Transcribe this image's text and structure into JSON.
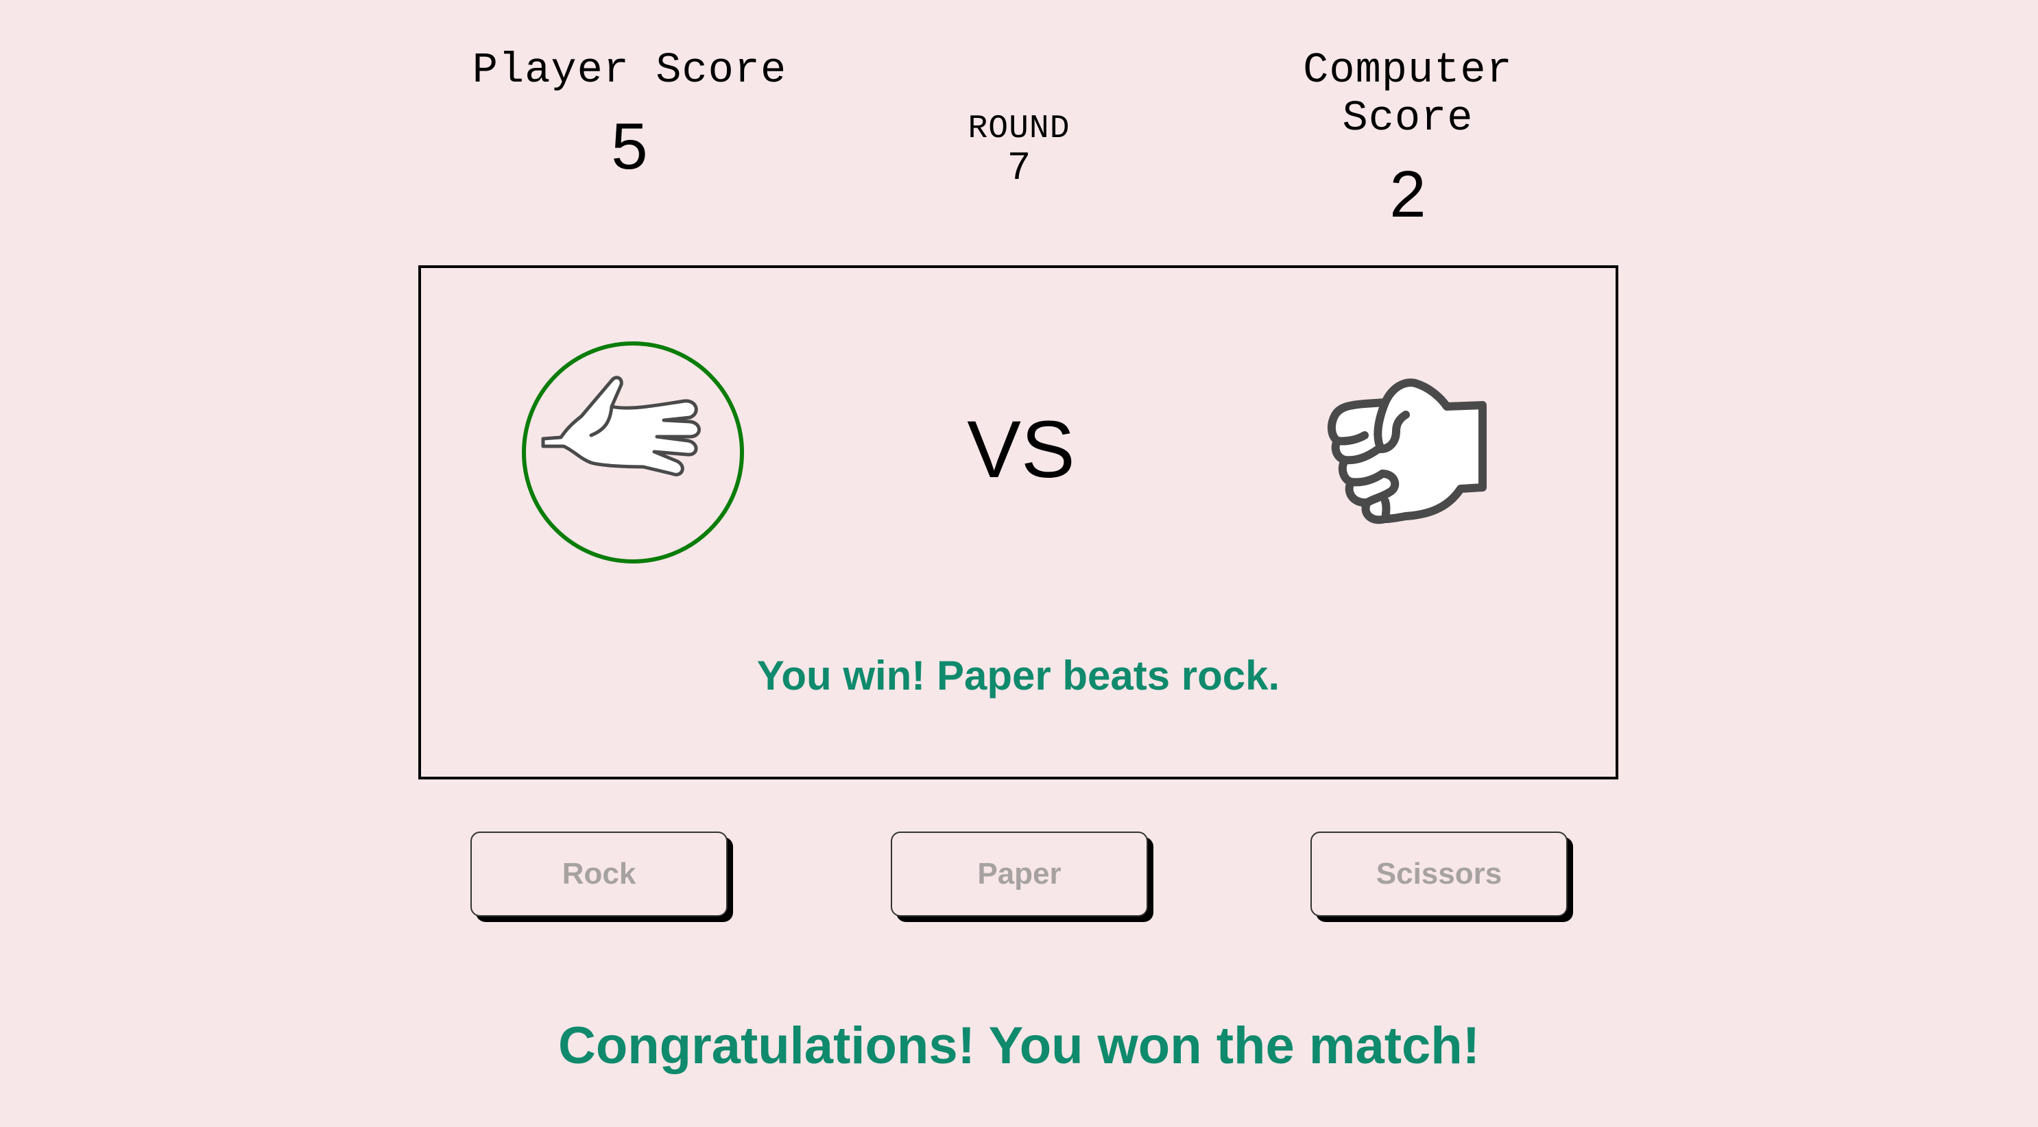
{
  "scores": {
    "player_label": "Player Score",
    "player_value": "5",
    "computer_label": "Computer Score",
    "computer_value": "2"
  },
  "round": {
    "label": "ROUND",
    "value": "7"
  },
  "arena": {
    "vs_label": "VS",
    "player_choice_icon": "paper-hand-icon",
    "computer_choice_icon": "rock-fist-icon",
    "result_text": "You win! Paper beats rock."
  },
  "buttons": {
    "rock_label": "Rock",
    "paper_label": "Paper",
    "scissors_label": "Scissors"
  },
  "final_message": "Congratulations! You won the match!",
  "colors": {
    "background": "#f8e7e8",
    "win_text": "#0f8a6d",
    "winner_ring": "#0a7d0a",
    "disabled_button_text": "#a7a2a2"
  }
}
